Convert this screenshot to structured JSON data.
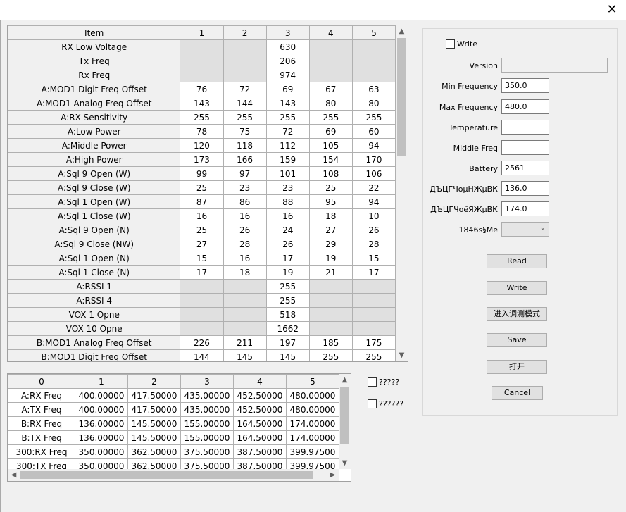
{
  "window": {
    "close_glyph": "✕"
  },
  "main_grid": {
    "headers": [
      "Item",
      "1",
      "2",
      "3",
      "4",
      "5"
    ],
    "rows": [
      {
        "item": "RX Low Voltage",
        "v": [
          "",
          "",
          "630",
          "",
          ""
        ],
        "gray": [
          true,
          true,
          false,
          true,
          true
        ]
      },
      {
        "item": "Tx Freq",
        "v": [
          "",
          "",
          "206",
          "",
          ""
        ],
        "gray": [
          true,
          true,
          false,
          true,
          true
        ]
      },
      {
        "item": "Rx Freq",
        "v": [
          "",
          "",
          "974",
          "",
          ""
        ],
        "gray": [
          true,
          true,
          false,
          true,
          true
        ]
      },
      {
        "item": "A:MOD1 Digit Freq Offset",
        "v": [
          "76",
          "72",
          "69",
          "67",
          "63"
        ]
      },
      {
        "item": "A:MOD1 Analog Freq Offset",
        "v": [
          "143",
          "144",
          "143",
          "80",
          "80"
        ]
      },
      {
        "item": "A:RX Sensitivity",
        "v": [
          "255",
          "255",
          "255",
          "255",
          "255"
        ]
      },
      {
        "item": "A:Low Power",
        "v": [
          "78",
          "75",
          "72",
          "69",
          "60"
        ]
      },
      {
        "item": "A:Middle Power",
        "v": [
          "120",
          "118",
          "112",
          "105",
          "94"
        ]
      },
      {
        "item": "A:High Power",
        "v": [
          "173",
          "166",
          "159",
          "154",
          "170"
        ]
      },
      {
        "item": "A:Sql 9 Open (W)",
        "v": [
          "99",
          "97",
          "101",
          "108",
          "106"
        ]
      },
      {
        "item": "A:Sql 9 Close (W)",
        "v": [
          "25",
          "23",
          "23",
          "25",
          "22"
        ]
      },
      {
        "item": "A:Sql 1 Open (W)",
        "v": [
          "87",
          "86",
          "88",
          "95",
          "94"
        ]
      },
      {
        "item": "A:Sql 1 Close (W)",
        "v": [
          "16",
          "16",
          "16",
          "18",
          "10"
        ]
      },
      {
        "item": "A:Sql 9 Open (N)",
        "v": [
          "25",
          "26",
          "24",
          "27",
          "26"
        ]
      },
      {
        "item": "A:Sql 9 Close (NW)",
        "v": [
          "27",
          "28",
          "26",
          "29",
          "28"
        ]
      },
      {
        "item": "A:Sql 1 Open (N)",
        "v": [
          "15",
          "16",
          "17",
          "19",
          "15"
        ]
      },
      {
        "item": "A:Sql 1 Close (N)",
        "v": [
          "17",
          "18",
          "19",
          "21",
          "17"
        ]
      },
      {
        "item": "A:RSSI 1",
        "v": [
          "",
          "",
          "255",
          "",
          ""
        ],
        "gray": [
          true,
          true,
          false,
          true,
          true
        ]
      },
      {
        "item": "A:RSSI 4",
        "v": [
          "",
          "",
          "255",
          "",
          ""
        ],
        "gray": [
          true,
          true,
          false,
          true,
          true
        ]
      },
      {
        "item": "VOX 1 Opne",
        "v": [
          "",
          "",
          "518",
          "",
          ""
        ],
        "gray": [
          true,
          true,
          false,
          true,
          true
        ]
      },
      {
        "item": "VOX 10 Opne",
        "v": [
          "",
          "",
          "1662",
          "",
          ""
        ],
        "gray": [
          true,
          true,
          false,
          true,
          true
        ]
      },
      {
        "item": "B:MOD1 Analog Freq Offset",
        "v": [
          "226",
          "211",
          "197",
          "185",
          "175"
        ]
      },
      {
        "item": "B:MOD1 Digit Freq Offset",
        "v": [
          "144",
          "145",
          "145",
          "255",
          "255"
        ]
      }
    ],
    "scroll_up": "▲",
    "scroll_down": "▼"
  },
  "freq_grid": {
    "headers": [
      "0",
      "1",
      "2",
      "3",
      "4",
      "5"
    ],
    "rows": [
      [
        "A:RX Freq",
        "400.00000",
        "417.50000",
        "435.00000",
        "452.50000",
        "480.00000"
      ],
      [
        "A:TX Freq",
        "400.00000",
        "417.50000",
        "435.00000",
        "452.50000",
        "480.00000"
      ],
      [
        "B:RX Freq",
        "136.00000",
        "145.50000",
        "155.00000",
        "164.50000",
        "174.00000"
      ],
      [
        "B:TX Freq",
        "136.00000",
        "145.50000",
        "155.00000",
        "164.50000",
        "174.00000"
      ],
      [
        "300:RX Freq",
        "350.00000",
        "362.50000",
        "375.50000",
        "387.50000",
        "399.97500"
      ],
      [
        "300:TX Freq",
        "350.00000",
        "362.50000",
        "375.50000",
        "387.50000",
        "399.97500"
      ]
    ],
    "scroll_left": "◀",
    "scroll_right": "▶",
    "scroll_up": "▲",
    "scroll_down": "▼"
  },
  "mid_checks": [
    {
      "label": "?????",
      "checked": false
    },
    {
      "label": "??????",
      "checked": false
    }
  ],
  "panel": {
    "write_check": {
      "label": "Write",
      "checked": false
    },
    "fields": [
      {
        "label": "Version",
        "value": "",
        "disabled": true,
        "wide": true
      },
      {
        "label": "Min Frequency",
        "value": "350.0"
      },
      {
        "label": "Max Frequency",
        "value": "480.0"
      },
      {
        "label": "Temperature",
        "value": ""
      },
      {
        "label": "Middle Freq",
        "value": ""
      },
      {
        "label": "Battery",
        "value": "2561"
      },
      {
        "label": "ДЪЦГЧоµНЖµВК",
        "value": "136.0"
      },
      {
        "label": "ДЪЦГЧоёЯЖµВК",
        "value": "174.0"
      }
    ],
    "select": {
      "label": "1846s§Me",
      "value": "",
      "caret": "⌄"
    },
    "buttons": [
      "Read",
      "Write",
      "进入调测模式",
      "Save",
      "打开",
      "Cancel"
    ]
  }
}
